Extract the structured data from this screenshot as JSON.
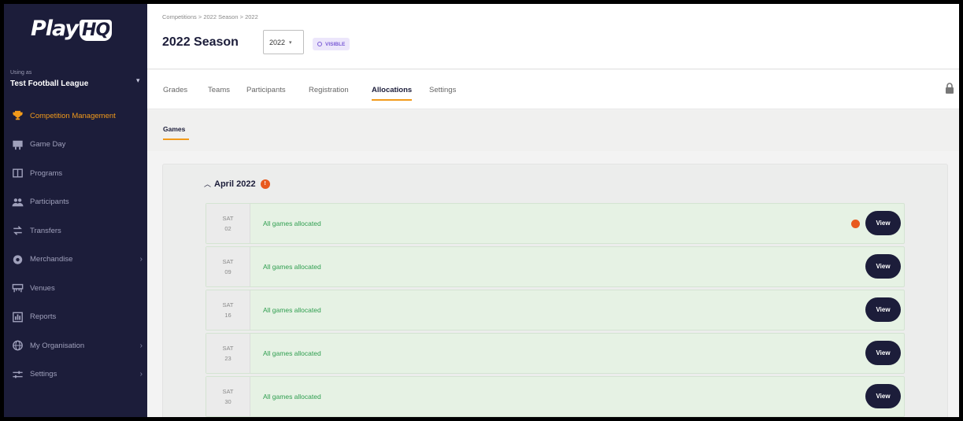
{
  "brand": {
    "logo_play": "Play",
    "logo_hq": "HQ",
    "accent": "#f29a1a",
    "navy": "#1c1d3a",
    "alert": "#e8591e",
    "success": "#2f9e4f"
  },
  "sidebar": {
    "using_label": "Using as",
    "org_name": "Test Football League",
    "items": [
      {
        "label": "Competition Management",
        "icon": "trophy-icon"
      },
      {
        "label": "Game Day",
        "icon": "scoreboard-icon"
      },
      {
        "label": "Programs",
        "icon": "book-icon"
      },
      {
        "label": "Participants",
        "icon": "people-icon"
      },
      {
        "label": "Transfers",
        "icon": "transfer-icon"
      },
      {
        "label": "Merchandise",
        "icon": "shirt-icon"
      },
      {
        "label": "Venues",
        "icon": "venue-icon"
      },
      {
        "label": "Reports",
        "icon": "reports-icon"
      },
      {
        "label": "My Organisation",
        "icon": "globe-icon"
      },
      {
        "label": "Settings",
        "icon": "sliders-icon"
      }
    ]
  },
  "header": {
    "breadcrumb": "Competitions  >  2022 Season  >  2022",
    "title": "2022 Season",
    "year_value": "2022",
    "status_badge": "VISIBLE"
  },
  "tabs": [
    "Grades",
    "Teams",
    "Participants",
    "Registration",
    "Allocations",
    "Settings"
  ],
  "active_tab": "Allocations",
  "subtab": "Games",
  "month": {
    "label": "April 2022",
    "alert_count": "!"
  },
  "games": [
    {
      "day": "SAT",
      "date": "02",
      "status": "All games allocated",
      "has_alert": true,
      "button": "View"
    },
    {
      "day": "SAT",
      "date": "09",
      "status": "All games allocated",
      "has_alert": false,
      "button": "View"
    },
    {
      "day": "SAT",
      "date": "16",
      "status": "All games allocated",
      "has_alert": false,
      "button": "View"
    },
    {
      "day": "SAT",
      "date": "23",
      "status": "All games allocated",
      "has_alert": false,
      "button": "View"
    },
    {
      "day": "SAT",
      "date": "30",
      "status": "All games allocated",
      "has_alert": false,
      "button": "View"
    }
  ]
}
